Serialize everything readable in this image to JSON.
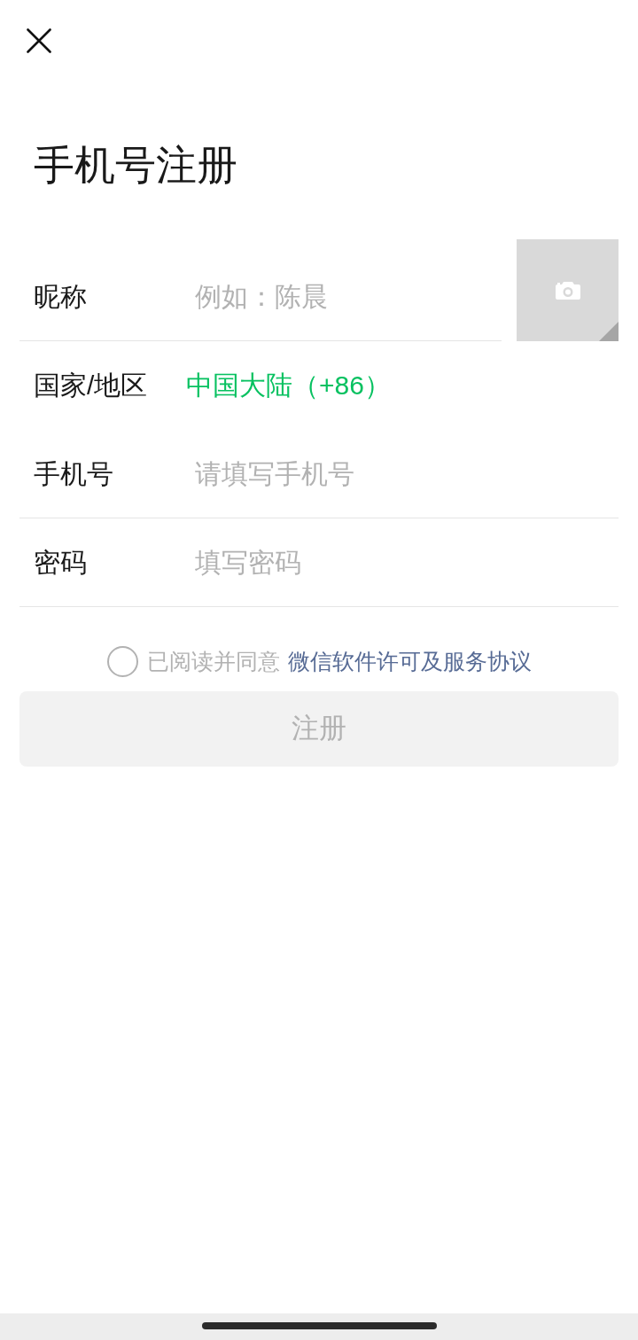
{
  "title": "手机号注册",
  "fields": [
    {
      "kind": "text",
      "label": "昵称",
      "placeholder": "例如：陈晨"
    },
    {
      "kind": "select",
      "label": "国家/地区",
      "value": "中国大陆（+86）"
    },
    {
      "kind": "text",
      "label": "手机号",
      "placeholder": "请填写手机号"
    },
    {
      "kind": "password",
      "label": "密码",
      "placeholder": "填写密码"
    }
  ],
  "agreement": {
    "checked": false,
    "text": "已阅读并同意",
    "link": "微信软件许可及服务协议"
  },
  "register_button": {
    "label": "注册",
    "disabled": true
  }
}
